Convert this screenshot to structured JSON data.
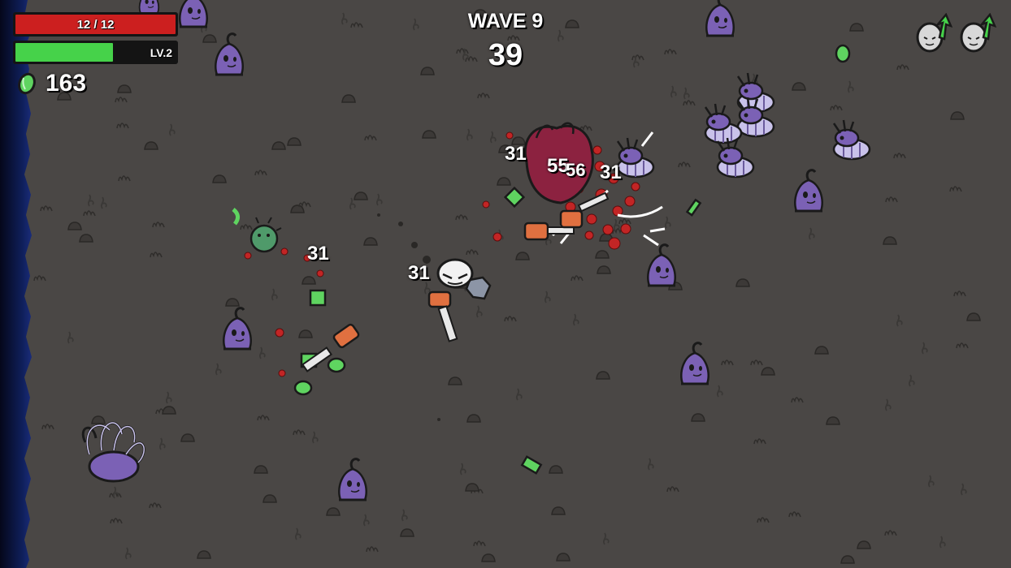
{
  "hud": {
    "health": {
      "label": "12 / 12",
      "current": 12,
      "max": 12,
      "color": "#cc1f1f"
    },
    "experience": {
      "label": "LV.2",
      "fill_fraction": 0.61,
      "color": "#46d24a"
    },
    "materials": {
      "count": "163",
      "icon": "material-icon"
    },
    "wave": {
      "label": "WAVE 9",
      "timer": "39"
    },
    "upgrades": [
      {
        "icon": "level-up-upgrade-icon"
      },
      {
        "icon": "level-up-upgrade-icon"
      }
    ]
  },
  "damage_numbers": [
    "31",
    "55",
    "56",
    "31",
    "31",
    "31"
  ],
  "colors": {
    "ground": "#4a4745",
    "enemy": "#7b61b5",
    "material": "#5fd460",
    "blood": "#c22525",
    "void_edge": "#0d1a4a"
  }
}
